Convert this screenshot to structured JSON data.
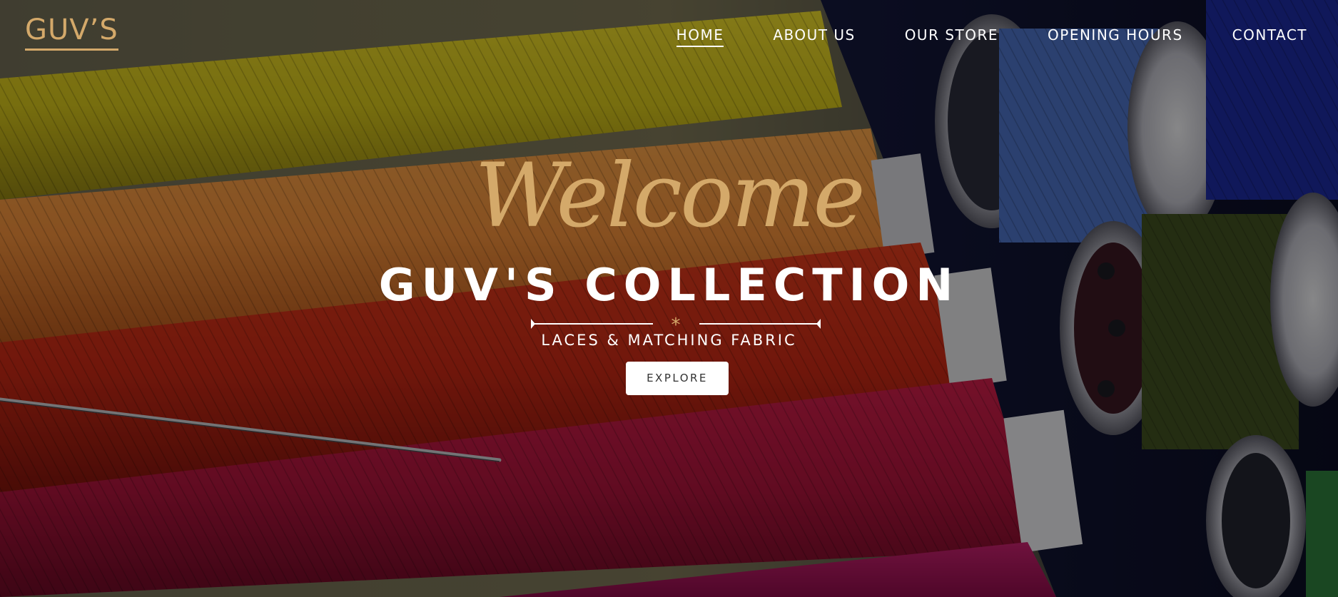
{
  "brand": {
    "logo_text": "GUV’S",
    "accent_color": "#d4a96a"
  },
  "nav": {
    "items": [
      {
        "label": "HOME",
        "active": true
      },
      {
        "label": "ABOUT US",
        "active": false
      },
      {
        "label": "OUR STORE",
        "active": false
      },
      {
        "label": "OPENING HOURS",
        "active": false
      },
      {
        "label": "CONTACT",
        "active": false
      }
    ]
  },
  "hero": {
    "script_heading": "Welcome",
    "title": "GUV'S COLLECTION",
    "divider_ornament": "*",
    "subtitle": "LACES & MATCHING FABRIC",
    "button_label": "EXPLORE",
    "background": "thread-spools-photo"
  }
}
